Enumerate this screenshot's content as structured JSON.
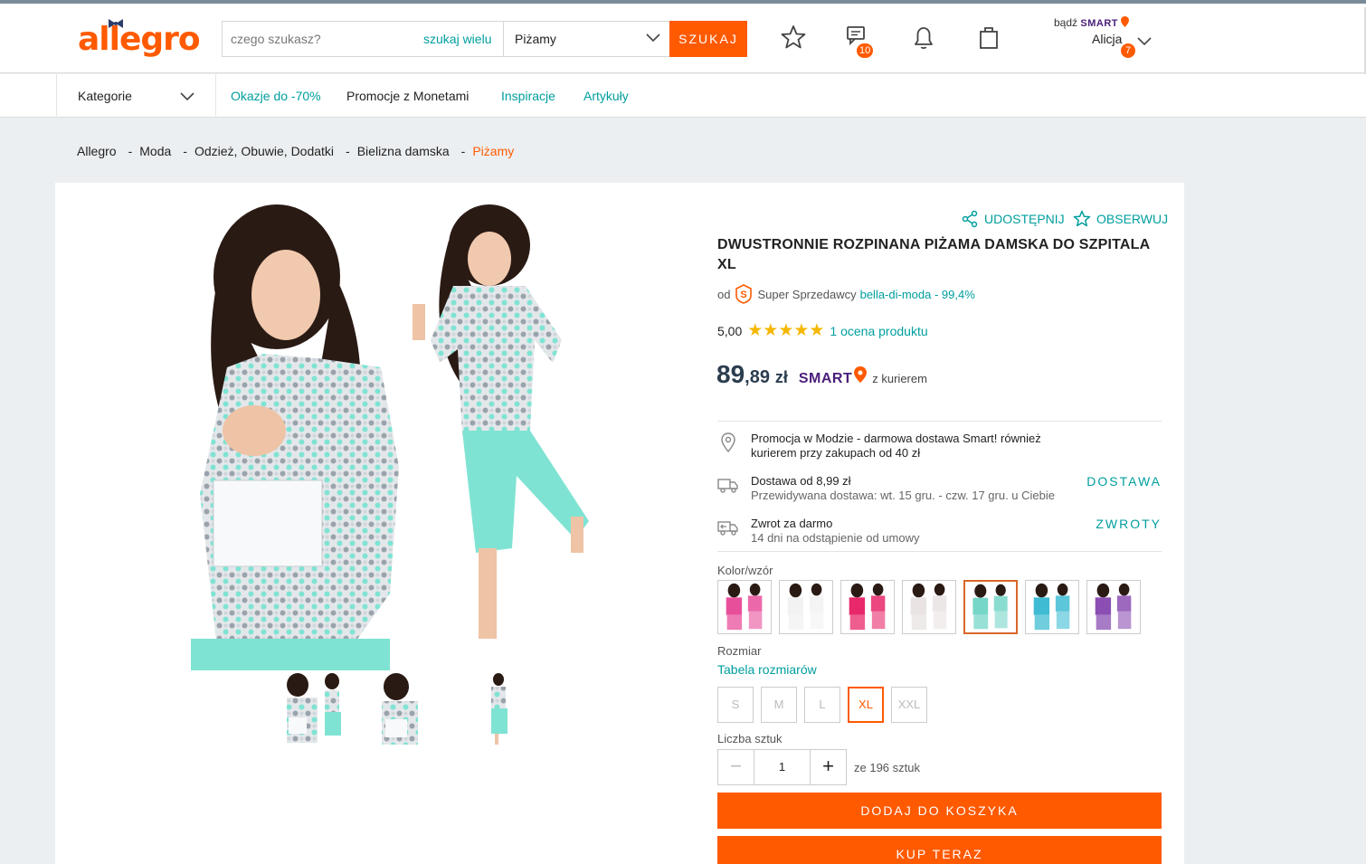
{
  "header": {
    "logo": "allegro",
    "search_placeholder": "czego szukasz?",
    "search_many": "szukaj wielu",
    "search_category": "Piżamy",
    "search_button": "SZUKAJ",
    "messages_count": "10",
    "smart_prefix": "bądź",
    "smart_label": "SMART",
    "user_name": "Alicja",
    "user_badge": "7"
  },
  "nav": {
    "categories": "Kategorie",
    "links": [
      "Okazje do -70%",
      "Promocje z Monetami",
      "Inspiracje",
      "Artykuły"
    ]
  },
  "breadcrumb": [
    "Allegro",
    "Moda",
    "Odzież, Obuwie, Dodatki",
    "Bielizna damska",
    "Piżamy"
  ],
  "product": {
    "share": "UDOSTĘPNIJ",
    "watch": "OBSERWUJ",
    "title": "DWUSTRONNIE ROZPINANA PIŻAMA DAMSKA DO SZPITALA XL",
    "seller_prefix": "od",
    "seller_type": "Super Sprzedawcy",
    "seller_name": "bella-di-moda - 99,4%",
    "rating_value": "5,00",
    "stars": "★★★★★",
    "rating_count": "1 ocena produktu",
    "price_whole": "89",
    "price_cents": ",89",
    "price_currency": "zł",
    "smart": "SMART",
    "courier": "z kurierem",
    "promo_line1": "Promocja w Modzie - darmowa dostawa Smart! również",
    "promo_line2": "kurierem przy zakupach od 40 zł",
    "delivery_title": "Dostawa od 8,99 zł",
    "delivery_sub": "Przewidywana dostawa: wt. 15 gru. - czw. 17 gru. u Ciebie",
    "delivery_link": "DOSTAWA",
    "return_title": "Zwrot za darmo",
    "return_sub": "14 dni na odstąpienie od umowy",
    "return_link": "ZWROTY",
    "color_label": "Kolor/wzór",
    "variant_colors": [
      "#e84f9b",
      "#f2f2f2",
      "#e8286a",
      "#e9e3e3",
      "#76d6c8",
      "#3fbcd3",
      "#8b4fb3"
    ],
    "size_label": "Rozmiar",
    "size_table": "Tabela rozmiarów",
    "sizes": [
      "S",
      "M",
      "L",
      "XL",
      "XXL"
    ],
    "quantity_label": "Liczba sztuk",
    "quantity": "1",
    "minus": "−",
    "plus": "+",
    "stock": "ze 196 sztuk",
    "add_to_cart": "DODAJ DO KOSZYKA",
    "buy_now": "KUP TERAZ"
  },
  "colors": {
    "accent": "#ff5a00",
    "link": "#009e9e",
    "smart": "#4a1e7a",
    "mint": "#7fe3d3"
  }
}
